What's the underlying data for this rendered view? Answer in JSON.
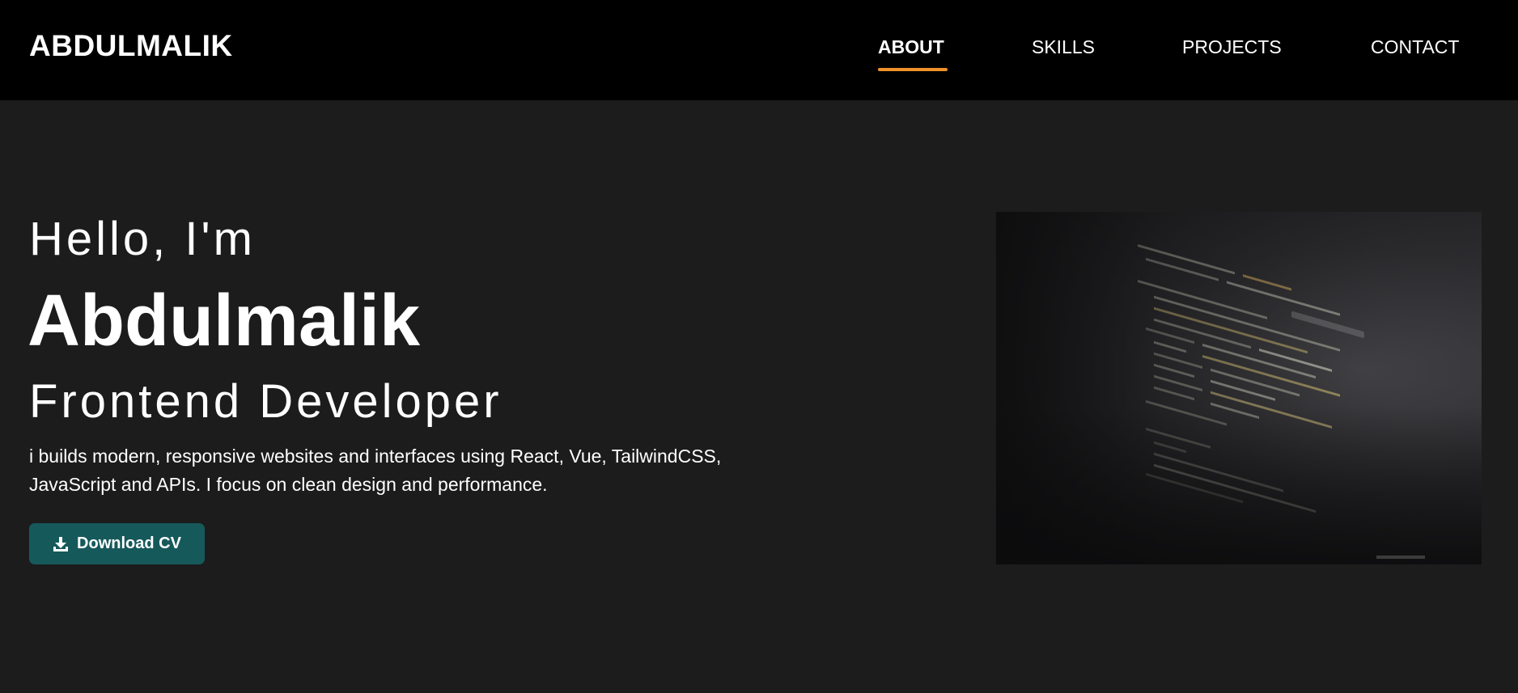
{
  "header": {
    "brand": "ABDULMALIK",
    "nav": [
      {
        "label": "ABOUT",
        "active": true
      },
      {
        "label": "SKILLS",
        "active": false
      },
      {
        "label": "PROJECTS",
        "active": false
      },
      {
        "label": "CONTACT",
        "active": false
      }
    ]
  },
  "hero": {
    "greeting": "Hello, I'm",
    "name": "Abdulmalik",
    "role": "Frontend Developer",
    "description": "i builds modern, responsive websites and interfaces using React, Vue, TailwindCSS, JavaScript and APIs. I focus on clean design and performance.",
    "cv_button": {
      "label": "Download CV",
      "icon": "download-icon"
    },
    "image": {
      "subject": "code-on-screen"
    }
  },
  "colors": {
    "nav_background": "#000000",
    "page_background": "#1d1c1d",
    "active_underline": "#f0922b",
    "button_background": "#16595b",
    "text": "#ffffff"
  }
}
